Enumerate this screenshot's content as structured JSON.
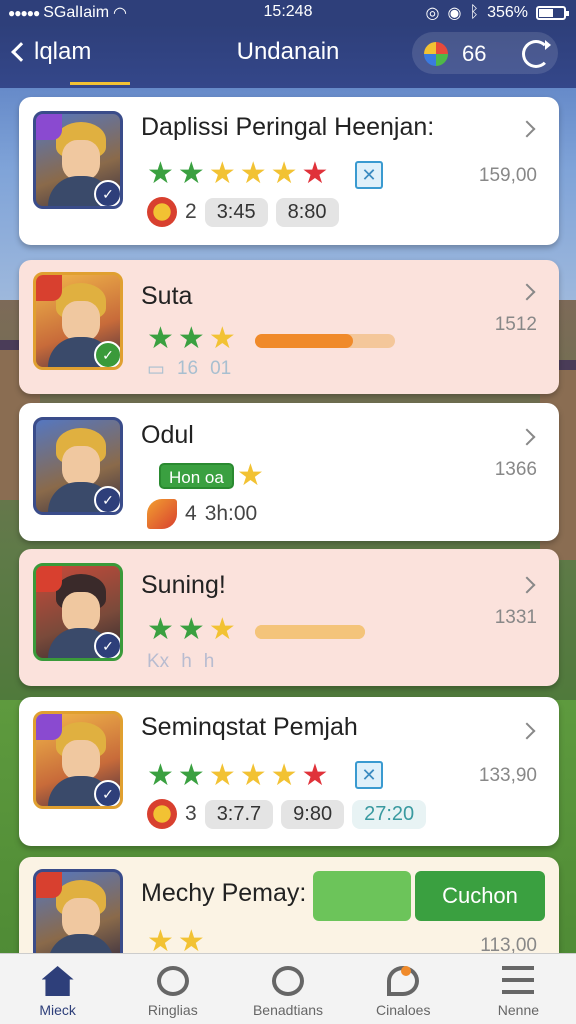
{
  "statusbar": {
    "carrier": "SGalIaim",
    "time": "15:248",
    "battery": "356%",
    "battery_level": 0.6
  },
  "header": {
    "back_label": "lqlam",
    "title": "Undanain",
    "coin_count": "66"
  },
  "cards": [
    {
      "title": "Daplissi Peringal Heenjan:",
      "score": "159,00",
      "stars": [
        "green",
        "green",
        "yellow",
        "yellow",
        "yellow",
        "red"
      ],
      "stat_number": "2",
      "pill_a": "3:45",
      "pill_b": "8:80"
    },
    {
      "title": "Suta",
      "score": "1512",
      "stars": [
        "green",
        "green",
        "yellow"
      ],
      "progress": 0.7,
      "faded_a": "16",
      "faded_b": "01"
    },
    {
      "title": "Odul",
      "score": "1366",
      "tag": "Hon oa",
      "stat_number": "4",
      "stat_value": "3h:00"
    },
    {
      "title": "Suning!",
      "score": "1331",
      "stars": [
        "green",
        "green",
        "yellow"
      ],
      "progress": 1.0,
      "faded_a": "Kx",
      "faded_b": "h",
      "faded_c": "h"
    },
    {
      "title": "Seminqstat Pemjah",
      "score": "133,90",
      "stars": [
        "green",
        "green",
        "yellow",
        "yellow",
        "yellow",
        "red"
      ],
      "stat_number": "3",
      "pill_a": "3:7.7",
      "pill_b": "9:80",
      "pill_c": "27:20"
    },
    {
      "title": "Mechy Pemay:",
      "button_label": "Cuchon",
      "score": "113,00"
    }
  ],
  "tabs": [
    {
      "label": "Mieck",
      "icon": "home-icon",
      "active": true
    },
    {
      "label": "Ringlias",
      "icon": "ring-icon",
      "active": false
    },
    {
      "label": "Benadtians",
      "icon": "crossed-swords-icon",
      "active": false
    },
    {
      "label": "Cinaloes",
      "icon": "chat-icon",
      "active": false
    },
    {
      "label": "Nenne",
      "icon": "menu-icon",
      "active": false
    }
  ],
  "colors": {
    "accent": "#2e3f7a",
    "green": "#3aa040",
    "pink_card": "#fbe2dc",
    "orange": "#f08a2a"
  }
}
